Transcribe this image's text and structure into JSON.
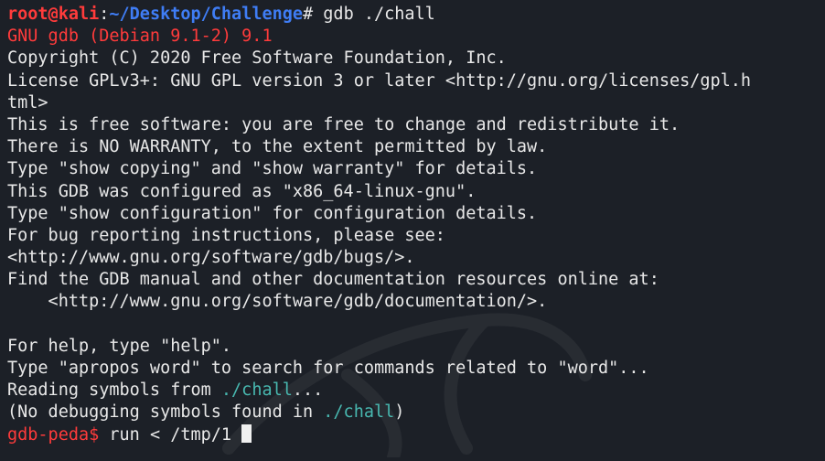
{
  "prompt": {
    "user_host": "root@kali",
    "sep": ":",
    "path": "~/Desktop/Challenge",
    "symbol": "#",
    "command": " gdb ./chall"
  },
  "output": {
    "gdb_version": "GNU gdb (Debian 9.1-2) 9.1",
    "copyright": "Copyright (C) 2020 Free Software Foundation, Inc.",
    "license_1": "License GPLv3+: GNU GPL version 3 or later <http://gnu.org/licenses/gpl.h",
    "license_2": "tml>",
    "free_sw": "This is free software: you are free to change and redistribute it.",
    "no_warranty": "There is NO WARRANTY, to the extent permitted by law.",
    "show_copying": "Type \"show copying\" and \"show warranty\" for details.",
    "configured": "This GDB was configured as \"x86_64-linux-gnu\".",
    "show_config": "Type \"show configuration\" for configuration details.",
    "bug_report": "For bug reporting instructions, please see:",
    "bugs_url": "<http://www.gnu.org/software/gdb/bugs/>.",
    "manual": "Find the GDB manual and other documentation resources online at:",
    "doc_url": "    <http://www.gnu.org/software/gdb/documentation/>.",
    "blank": "",
    "help": "For help, type \"help\".",
    "apropos": "Type \"apropos word\" to search for commands related to \"word\"...",
    "reading_prefix": "Reading symbols from ",
    "reading_file": "./chall",
    "reading_suffix": "...",
    "nodebug_prefix": "(No debugging symbols found in ",
    "nodebug_file": "./chall",
    "nodebug_suffix": ")"
  },
  "peda": {
    "prompt": "gdb-peda$",
    "command": " run < /tmp/1 "
  }
}
